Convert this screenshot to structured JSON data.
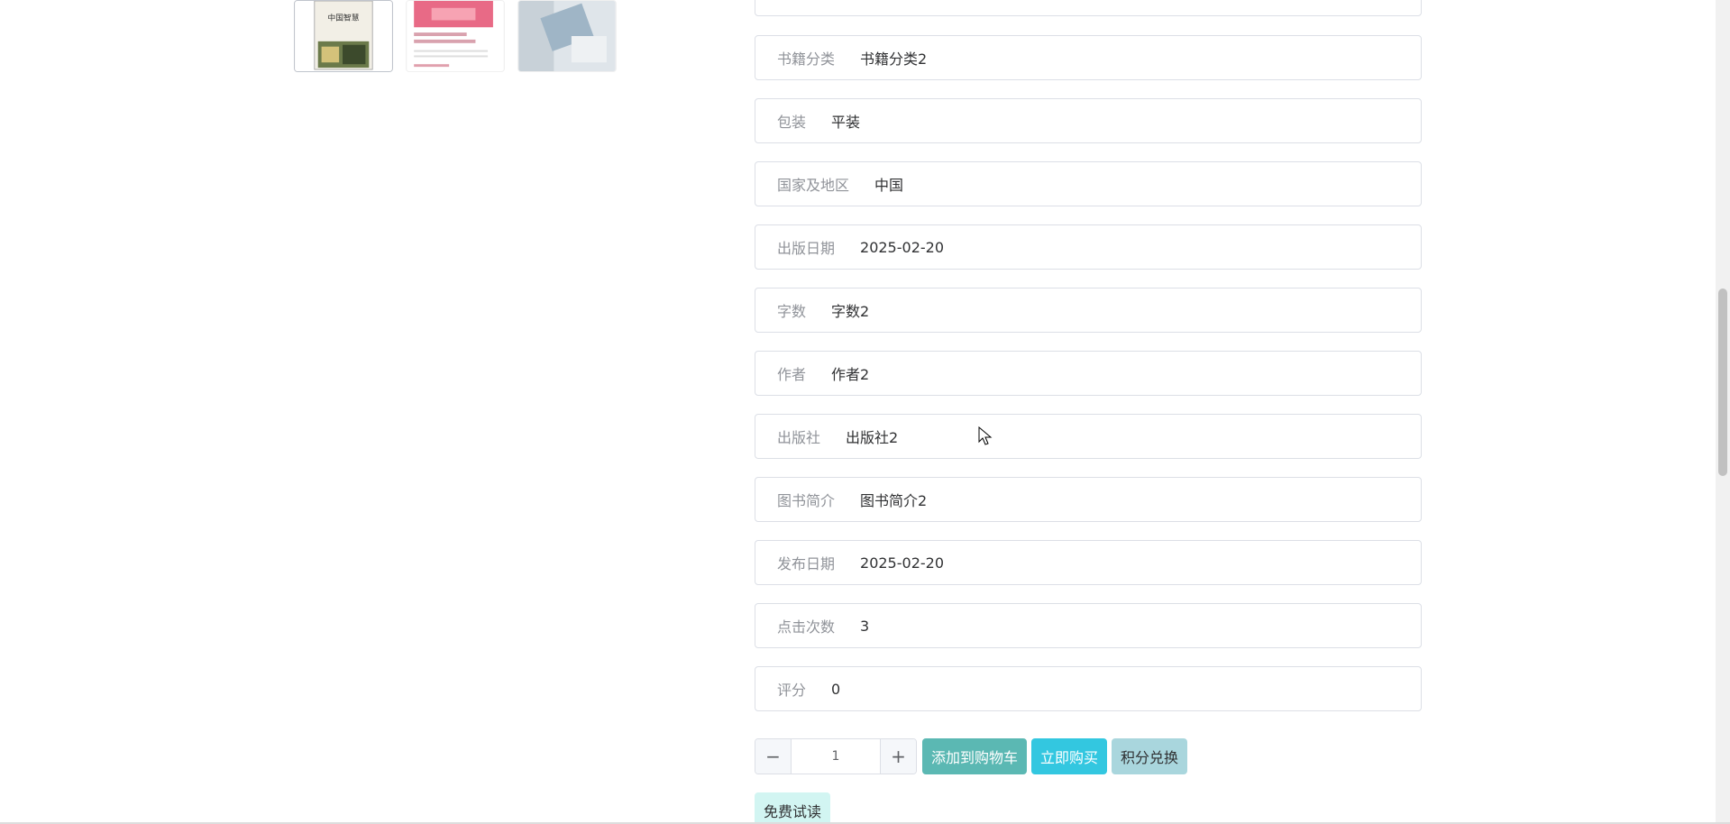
{
  "thumbnails": [
    {
      "icon": "book-cover-image",
      "title": "中国智慧"
    },
    {
      "icon": "book-cover-image"
    },
    {
      "icon": "book-cover-image"
    }
  ],
  "fields": [
    {
      "label": "书籍分类",
      "value": "书籍分类2"
    },
    {
      "label": "包装",
      "value": "平装"
    },
    {
      "label": "国家及地区",
      "value": "中国"
    },
    {
      "label": "出版日期",
      "value": "2025-02-20"
    },
    {
      "label": "字数",
      "value": "字数2"
    },
    {
      "label": "作者",
      "value": "作者2"
    },
    {
      "label": "出版社",
      "value": "出版社2"
    },
    {
      "label": "图书简介",
      "value": "图书简介2"
    },
    {
      "label": "发布日期",
      "value": "2025-02-20"
    },
    {
      "label": "点击次数",
      "value": "3"
    },
    {
      "label": "评分",
      "value": "0"
    }
  ],
  "quantity": {
    "minus": "−",
    "value": "1",
    "plus": "+"
  },
  "buttons": {
    "add_to_cart": "添加到购物车",
    "buy_now": "立即购买",
    "points_exchange": "积分兑换",
    "free_trial": "免费试读"
  },
  "colors": {
    "cart": "#5bb8b3",
    "buy": "#33c7e0",
    "points": "#a9d6dd",
    "trial": "#d2f5f2"
  }
}
